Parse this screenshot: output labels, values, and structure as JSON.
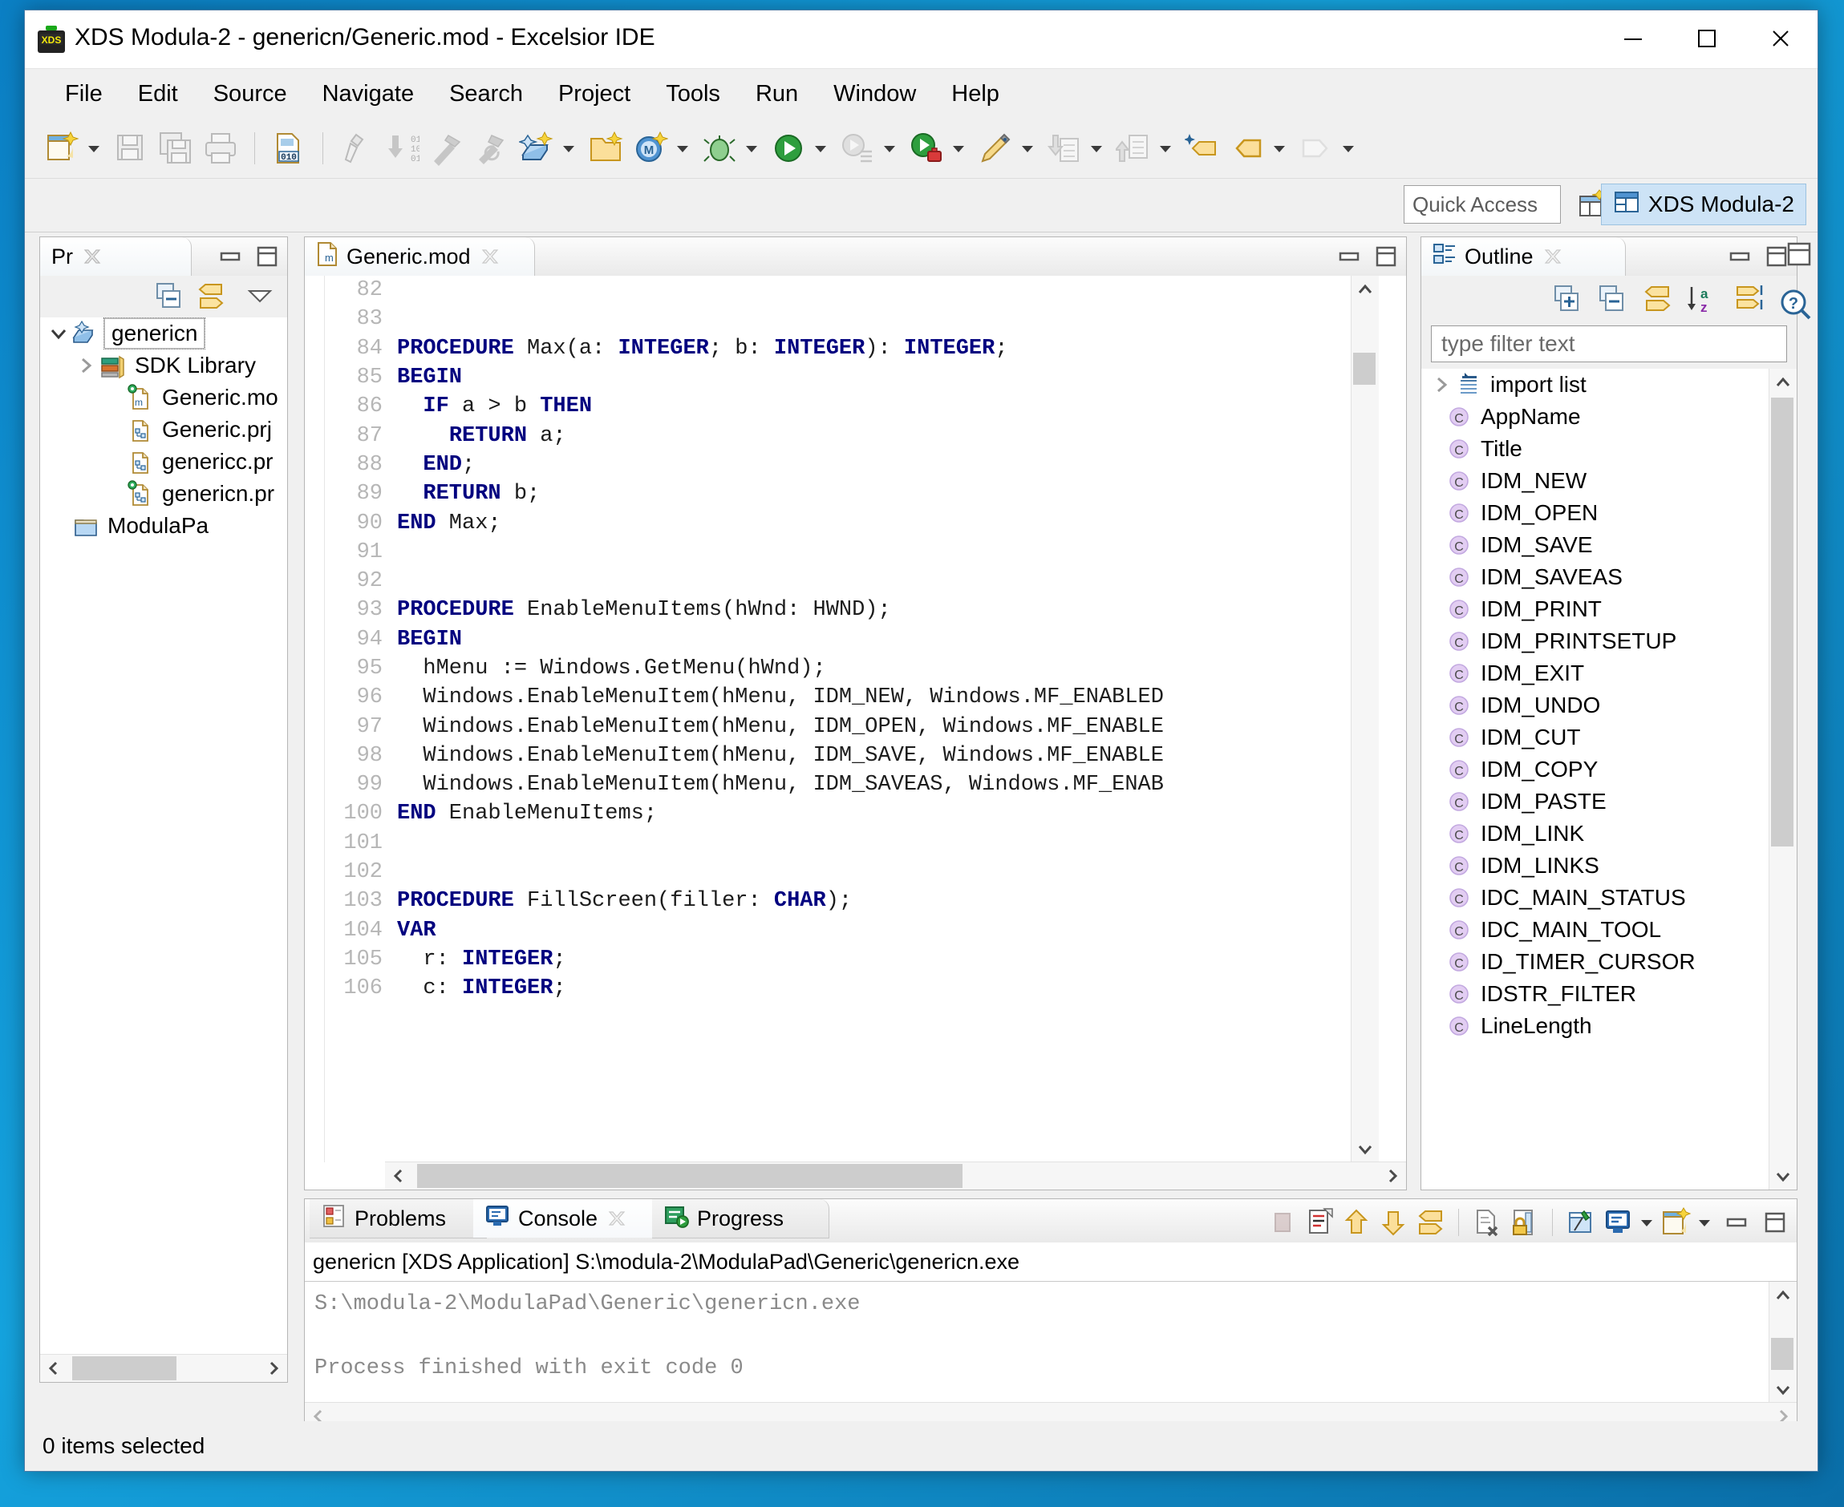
{
  "window": {
    "title": "XDS Modula-2 - genericn/Generic.mod - Excelsior IDE",
    "app_icon": "xds-icon",
    "minimize": "–",
    "maximize": "□",
    "close": "✕"
  },
  "menubar": {
    "items": [
      "File",
      "Edit",
      "Source",
      "Navigate",
      "Search",
      "Project",
      "Tools",
      "Run",
      "Window",
      "Help"
    ]
  },
  "toolbar": {
    "groups": [
      {
        "items": [
          {
            "name": "new-wizard-icon",
            "kind": "new",
            "dim": false,
            "arrow": true
          },
          {
            "name": "save-icon",
            "kind": "save",
            "dim": true,
            "arrow": false
          },
          {
            "name": "save-all-icon",
            "kind": "saveall",
            "dim": true,
            "arrow": false
          },
          {
            "name": "print-icon",
            "kind": "print",
            "dim": true,
            "arrow": false
          }
        ]
      },
      {
        "items": [
          {
            "name": "hex-editor-icon",
            "kind": "hex",
            "dim": false,
            "arrow": false
          }
        ]
      },
      {
        "items": [
          {
            "name": "compile-icon",
            "kind": "compile",
            "dim": true,
            "arrow": false
          },
          {
            "name": "make-icon",
            "kind": "make",
            "dim": true,
            "arrow": false
          },
          {
            "name": "build-icon",
            "kind": "build",
            "dim": true,
            "arrow": false
          },
          {
            "name": "rebuild-icon",
            "kind": "rebuild",
            "dim": true,
            "arrow": false
          },
          {
            "name": "new-project-wizard-icon",
            "kind": "newprj",
            "dim": false,
            "arrow": true
          },
          {
            "name": "new-folder-icon",
            "kind": "newfolder",
            "dim": false,
            "arrow": false
          },
          {
            "name": "new-module-icon",
            "kind": "newmodule",
            "dim": false,
            "arrow": true
          },
          {
            "name": "debug-icon",
            "kind": "debug",
            "dim": false,
            "arrow": true
          },
          {
            "name": "run-icon",
            "kind": "run",
            "dim": false,
            "arrow": true
          },
          {
            "name": "run-history-icon",
            "kind": "runhist",
            "dim": true,
            "arrow": true
          },
          {
            "name": "run-external-tool-icon",
            "kind": "exttool",
            "dim": false,
            "arrow": true
          },
          {
            "name": "pencil-icon",
            "kind": "pencil",
            "dim": false,
            "arrow": true
          },
          {
            "name": "previous-annotation-icon",
            "kind": "downsheet",
            "dim": true,
            "arrow": true
          },
          {
            "name": "next-annotation-icon",
            "kind": "upsheet",
            "dim": true,
            "arrow": true
          },
          {
            "name": "last-edit-location-icon",
            "kind": "lastedit",
            "dim": false,
            "arrow": false
          },
          {
            "name": "back-icon",
            "kind": "back",
            "dim": false,
            "arrow": true
          },
          {
            "name": "forward-icon",
            "kind": "forward",
            "dim": true,
            "arrow": true
          }
        ]
      }
    ]
  },
  "quick_access": {
    "placeholder": "Quick Access",
    "open_perspective_label": "open-perspective",
    "perspective": "XDS Modula-2"
  },
  "project_explorer": {
    "tab_label": "Pr",
    "toolbar": [
      "collapse-all-icon",
      "link-with-editor-icon",
      "view-menu-icon"
    ],
    "tree": [
      {
        "label": "genericn",
        "icon": "project-icon",
        "indent": 0,
        "twisty": "down",
        "selected": true
      },
      {
        "label": "SDK Library",
        "icon": "library-icon",
        "indent": 1,
        "twisty": "right",
        "selected": false
      },
      {
        "label": "Generic.mo",
        "icon": "module-file-icon",
        "indent": 2,
        "twisty": "none",
        "selected": false
      },
      {
        "label": "Generic.prj",
        "icon": "project-file-icon",
        "indent": 2,
        "twisty": "none",
        "selected": false
      },
      {
        "label": "genericc.pr",
        "icon": "project-file-icon",
        "indent": 2,
        "twisty": "none",
        "selected": false
      },
      {
        "label": "genericn.pr",
        "icon": "project-file-icon-active",
        "indent": 2,
        "twisty": "none",
        "selected": false
      },
      {
        "label": "ModulaPa",
        "icon": "folder-icon",
        "indent": 0,
        "twisty": "none",
        "selected": false
      }
    ]
  },
  "editor": {
    "tab_label": "Generic.mod",
    "tab_icon": "module-file-icon",
    "first_line": 82,
    "lines": [
      {
        "n": 82,
        "segments": []
      },
      {
        "n": 83,
        "segments": []
      },
      {
        "n": 84,
        "segments": [
          {
            "t": "PROCEDURE",
            "k": true
          },
          {
            "t": " Max(a: ",
            "k": false
          },
          {
            "t": "INTEGER",
            "k": true
          },
          {
            "t": "; b: ",
            "k": false
          },
          {
            "t": "INTEGER",
            "k": true
          },
          {
            "t": "): ",
            "k": false
          },
          {
            "t": "INTEGER",
            "k": true
          },
          {
            "t": ";",
            "k": false
          }
        ]
      },
      {
        "n": 85,
        "segments": [
          {
            "t": "BEGIN",
            "k": true
          }
        ]
      },
      {
        "n": 86,
        "segments": [
          {
            "t": "  ",
            "k": false
          },
          {
            "t": "IF",
            "k": true
          },
          {
            "t": " a > b ",
            "k": false
          },
          {
            "t": "THEN",
            "k": true
          }
        ]
      },
      {
        "n": 87,
        "segments": [
          {
            "t": "    ",
            "k": false
          },
          {
            "t": "RETURN",
            "k": true
          },
          {
            "t": " a;",
            "k": false
          }
        ]
      },
      {
        "n": 88,
        "segments": [
          {
            "t": "  ",
            "k": false
          },
          {
            "t": "END",
            "k": true
          },
          {
            "t": ";",
            "k": false
          }
        ]
      },
      {
        "n": 89,
        "segments": [
          {
            "t": "  ",
            "k": false
          },
          {
            "t": "RETURN",
            "k": true
          },
          {
            "t": " b;",
            "k": false
          }
        ]
      },
      {
        "n": 90,
        "segments": [
          {
            "t": "END",
            "k": true
          },
          {
            "t": " Max;",
            "k": false
          }
        ]
      },
      {
        "n": 91,
        "segments": []
      },
      {
        "n": 92,
        "segments": []
      },
      {
        "n": 93,
        "segments": [
          {
            "t": "PROCEDURE",
            "k": true
          },
          {
            "t": " EnableMenuItems(hWnd: HWND);",
            "k": false
          }
        ]
      },
      {
        "n": 94,
        "segments": [
          {
            "t": "BEGIN",
            "k": true
          }
        ]
      },
      {
        "n": 95,
        "segments": [
          {
            "t": "  hMenu := Windows.GetMenu(hWnd);",
            "k": false
          }
        ]
      },
      {
        "n": 96,
        "segments": [
          {
            "t": "  Windows.EnableMenuItem(hMenu, IDM_NEW, Windows.MF_ENABLED",
            "k": false
          }
        ]
      },
      {
        "n": 97,
        "segments": [
          {
            "t": "  Windows.EnableMenuItem(hMenu, IDM_OPEN, Windows.MF_ENABLE",
            "k": false
          }
        ]
      },
      {
        "n": 98,
        "segments": [
          {
            "t": "  Windows.EnableMenuItem(hMenu, IDM_SAVE, Windows.MF_ENABLE",
            "k": false
          }
        ]
      },
      {
        "n": 99,
        "segments": [
          {
            "t": "  Windows.EnableMenuItem(hMenu, IDM_SAVEAS, Windows.MF_ENAB",
            "k": false
          }
        ]
      },
      {
        "n": 100,
        "segments": [
          {
            "t": "END",
            "k": true
          },
          {
            "t": " EnableMenuItems;",
            "k": false
          }
        ]
      },
      {
        "n": 101,
        "segments": []
      },
      {
        "n": 102,
        "segments": []
      },
      {
        "n": 103,
        "segments": [
          {
            "t": "PROCEDURE",
            "k": true
          },
          {
            "t": " FillScreen(filler: ",
            "k": false
          },
          {
            "t": "CHAR",
            "k": true
          },
          {
            "t": ");",
            "k": false
          }
        ]
      },
      {
        "n": 104,
        "segments": [
          {
            "t": "VAR",
            "k": true
          }
        ]
      },
      {
        "n": 105,
        "segments": [
          {
            "t": "  r: ",
            "k": false
          },
          {
            "t": "INTEGER",
            "k": true
          },
          {
            "t": ";",
            "k": false
          }
        ]
      },
      {
        "n": 106,
        "segments": [
          {
            "t": "  c: ",
            "k": false
          },
          {
            "t": "INTEGER",
            "k": true
          },
          {
            "t": ";",
            "k": false
          }
        ]
      }
    ]
  },
  "outline": {
    "tab_label": "Outline",
    "toolbar": [
      "expand-all-icon",
      "collapse-all-icon",
      "link-with-editor-icon",
      "sort-icon",
      "filter-icon"
    ],
    "filter_placeholder": "type filter text",
    "items": [
      {
        "label": "import list",
        "icon": "import-list-icon",
        "twisty": "right"
      },
      {
        "label": "AppName",
        "icon": "constant-icon",
        "twisty": "none"
      },
      {
        "label": "Title",
        "icon": "constant-icon",
        "twisty": "none"
      },
      {
        "label": "IDM_NEW",
        "icon": "constant-icon",
        "twisty": "none"
      },
      {
        "label": "IDM_OPEN",
        "icon": "constant-icon",
        "twisty": "none"
      },
      {
        "label": "IDM_SAVE",
        "icon": "constant-icon",
        "twisty": "none"
      },
      {
        "label": "IDM_SAVEAS",
        "icon": "constant-icon",
        "twisty": "none"
      },
      {
        "label": "IDM_PRINT",
        "icon": "constant-icon",
        "twisty": "none"
      },
      {
        "label": "IDM_PRINTSETUP",
        "icon": "constant-icon",
        "twisty": "none"
      },
      {
        "label": "IDM_EXIT",
        "icon": "constant-icon",
        "twisty": "none"
      },
      {
        "label": "IDM_UNDO",
        "icon": "constant-icon",
        "twisty": "none"
      },
      {
        "label": "IDM_CUT",
        "icon": "constant-icon",
        "twisty": "none"
      },
      {
        "label": "IDM_COPY",
        "icon": "constant-icon",
        "twisty": "none"
      },
      {
        "label": "IDM_PASTE",
        "icon": "constant-icon",
        "twisty": "none"
      },
      {
        "label": "IDM_LINK",
        "icon": "constant-icon",
        "twisty": "none"
      },
      {
        "label": "IDM_LINKS",
        "icon": "constant-icon",
        "twisty": "none"
      },
      {
        "label": "IDC_MAIN_STATUS",
        "icon": "constant-icon",
        "twisty": "none"
      },
      {
        "label": "IDC_MAIN_TOOL",
        "icon": "constant-icon",
        "twisty": "none"
      },
      {
        "label": "ID_TIMER_CURSOR",
        "icon": "constant-icon",
        "twisty": "none"
      },
      {
        "label": "IDSTR_FILTER",
        "icon": "constant-icon",
        "twisty": "none"
      },
      {
        "label": "LineLength",
        "icon": "constant-icon",
        "twisty": "none"
      }
    ]
  },
  "bottom_panel": {
    "tabs": [
      {
        "label": "Problems",
        "icon": "problems-icon",
        "active": false,
        "closable": false
      },
      {
        "label": "Console",
        "icon": "console-icon",
        "active": true,
        "closable": true
      },
      {
        "label": "Progress",
        "icon": "progress-icon",
        "active": false,
        "closable": false
      }
    ],
    "toolbar": [
      "terminate-icon",
      "display-selected-console-icon",
      "scroll-up-icon",
      "scroll-down-icon",
      "scroll-lock-icon",
      "clear-console-icon",
      "lock-console-icon",
      "pin-console-icon",
      "display-console-icon",
      "open-console-icon"
    ],
    "console_header": "genericn [XDS Application] S:\\modula-2\\ModulaPad\\Generic\\genericn.exe",
    "console_lines": [
      "S:\\modula-2\\ModulaPad\\Generic\\genericn.exe",
      "",
      "Process finished with exit code 0"
    ]
  },
  "statusbar": {
    "text": "0 items selected"
  },
  "colors": {
    "keyword": "#00007f",
    "accent": "#cde3f6",
    "chrome": "#f0f0f0",
    "desktop": "#0b7fc4"
  }
}
